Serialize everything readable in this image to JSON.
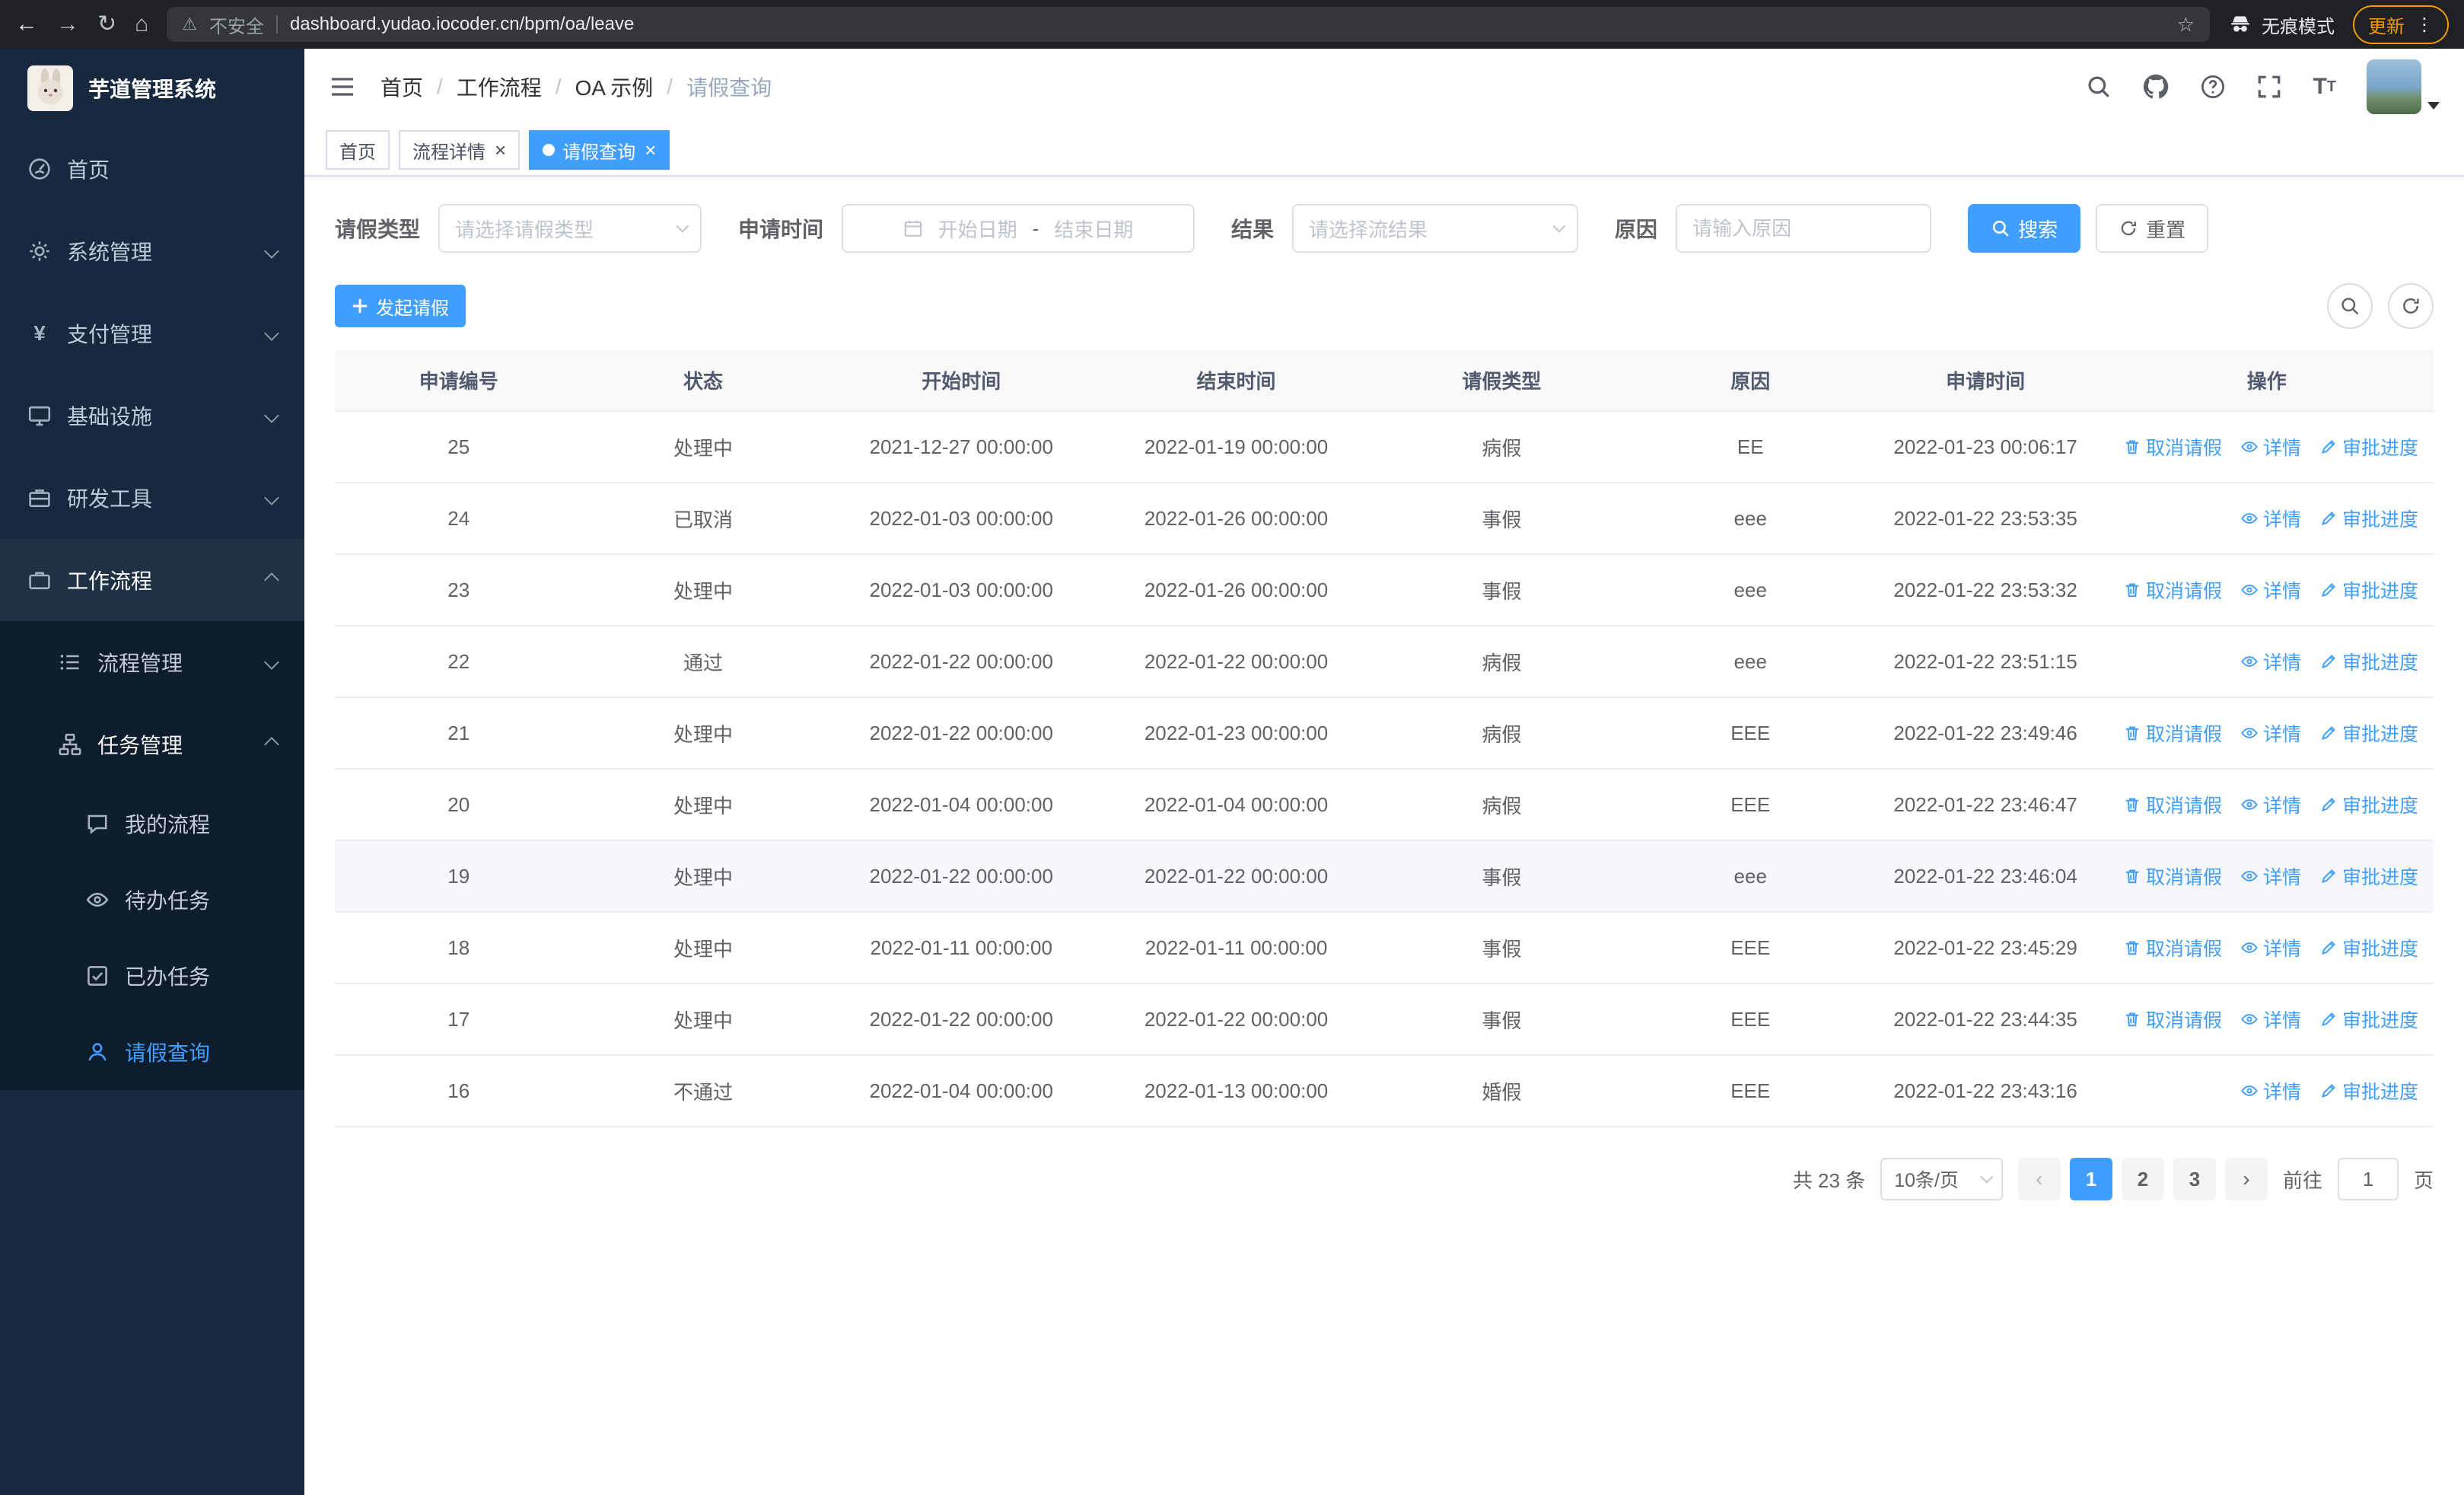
{
  "colors": {
    "primary": "#409eff",
    "sidebar_bg": "#16293e",
    "sidebar_sub_bg": "#0e1d2e",
    "update_accent": "#f29900"
  },
  "browser": {
    "icons": {
      "back": "←",
      "forward": "→",
      "reload": "↻",
      "home": "⌂",
      "star": "☆",
      "menu": "⋮",
      "warning": "⚠"
    },
    "warning_label": "不安全",
    "url": "dashboard.yudao.iocoder.cn/bpm/oa/leave",
    "incognito_label": "无痕模式",
    "update_label": "更新"
  },
  "sidebar": {
    "title": "芋道管理系统",
    "items": [
      {
        "label": "首页"
      },
      {
        "label": "系统管理"
      },
      {
        "label": "支付管理"
      },
      {
        "label": "基础设施"
      },
      {
        "label": "研发工具"
      },
      {
        "label": "工作流程"
      }
    ],
    "workflow_children": [
      {
        "label": "流程管理"
      },
      {
        "label": "任务管理"
      }
    ],
    "task_children": [
      {
        "label": "我的流程"
      },
      {
        "label": "待办任务"
      },
      {
        "label": "已办任务"
      },
      {
        "label": "请假查询"
      }
    ],
    "payment_icon_glyph": "¥"
  },
  "breadcrumb": {
    "items": [
      "首页",
      "工作流程",
      "OA 示例",
      "请假查询"
    ],
    "separator": "/"
  },
  "tabs": [
    {
      "label": "首页"
    },
    {
      "label": "流程详情"
    },
    {
      "label": "请假查询"
    }
  ],
  "filters": {
    "leave_type_label": "请假类型",
    "leave_type_placeholder": "请选择请假类型",
    "apply_time_label": "申请时间",
    "start_date_placeholder": "开始日期",
    "date_separator": "-",
    "end_date_placeholder": "结束日期",
    "result_label": "结果",
    "result_placeholder": "请选择流结果",
    "reason_label": "原因",
    "reason_placeholder": "请输入原因",
    "search_button": "搜索",
    "reset_button": "重置"
  },
  "toolbar": {
    "create_button": "发起请假"
  },
  "table": {
    "columns": [
      "申请编号",
      "状态",
      "开始时间",
      "结束时间",
      "请假类型",
      "原因",
      "申请时间",
      "操作"
    ],
    "action_labels": {
      "cancel": "取消请假",
      "detail": "详情",
      "progress": "审批进度"
    },
    "rows": [
      {
        "no": "25",
        "status": "处理中",
        "start": "2021-12-27 00:00:00",
        "end": "2022-01-19 00:00:00",
        "type": "病假",
        "reason": "EE",
        "applied": "2022-01-23 00:06:17",
        "actions": [
          "cancel",
          "detail",
          "progress"
        ],
        "highlight": false
      },
      {
        "no": "24",
        "status": "已取消",
        "start": "2022-01-03 00:00:00",
        "end": "2022-01-26 00:00:00",
        "type": "事假",
        "reason": "eee",
        "applied": "2022-01-22 23:53:35",
        "actions": [
          "detail",
          "progress"
        ],
        "highlight": false
      },
      {
        "no": "23",
        "status": "处理中",
        "start": "2022-01-03 00:00:00",
        "end": "2022-01-26 00:00:00",
        "type": "事假",
        "reason": "eee",
        "applied": "2022-01-22 23:53:32",
        "actions": [
          "cancel",
          "detail",
          "progress"
        ],
        "highlight": false
      },
      {
        "no": "22",
        "status": "通过",
        "start": "2022-01-22 00:00:00",
        "end": "2022-01-22 00:00:00",
        "type": "病假",
        "reason": "eee",
        "applied": "2022-01-22 23:51:15",
        "actions": [
          "detail",
          "progress"
        ],
        "highlight": false
      },
      {
        "no": "21",
        "status": "处理中",
        "start": "2022-01-22 00:00:00",
        "end": "2022-01-23 00:00:00",
        "type": "病假",
        "reason": "EEE",
        "applied": "2022-01-22 23:49:46",
        "actions": [
          "cancel",
          "detail",
          "progress"
        ],
        "highlight": false
      },
      {
        "no": "20",
        "status": "处理中",
        "start": "2022-01-04 00:00:00",
        "end": "2022-01-04 00:00:00",
        "type": "病假",
        "reason": "EEE",
        "applied": "2022-01-22 23:46:47",
        "actions": [
          "cancel",
          "detail",
          "progress"
        ],
        "highlight": false
      },
      {
        "no": "19",
        "status": "处理中",
        "start": "2022-01-22 00:00:00",
        "end": "2022-01-22 00:00:00",
        "type": "事假",
        "reason": "eee",
        "applied": "2022-01-22 23:46:04",
        "actions": [
          "cancel",
          "detail",
          "progress"
        ],
        "highlight": true
      },
      {
        "no": "18",
        "status": "处理中",
        "start": "2022-01-11 00:00:00",
        "end": "2022-01-11 00:00:00",
        "type": "事假",
        "reason": "EEE",
        "applied": "2022-01-22 23:45:29",
        "actions": [
          "cancel",
          "detail",
          "progress"
        ],
        "highlight": false
      },
      {
        "no": "17",
        "status": "处理中",
        "start": "2022-01-22 00:00:00",
        "end": "2022-01-22 00:00:00",
        "type": "事假",
        "reason": "EEE",
        "applied": "2022-01-22 23:44:35",
        "actions": [
          "cancel",
          "detail",
          "progress"
        ],
        "highlight": false
      },
      {
        "no": "16",
        "status": "不通过",
        "start": "2022-01-04 00:00:00",
        "end": "2022-01-13 00:00:00",
        "type": "婚假",
        "reason": "EEE",
        "applied": "2022-01-22 23:43:16",
        "actions": [
          "detail",
          "progress"
        ],
        "highlight": false
      }
    ]
  },
  "pagination": {
    "total_text": "共 23 条",
    "page_size": "10条/页",
    "prev_glyph": "‹",
    "next_glyph": "›",
    "pages": [
      "1",
      "2",
      "3"
    ],
    "active_page": "1",
    "goto_label": "前往",
    "goto_value": "1",
    "goto_suffix": "页"
  }
}
